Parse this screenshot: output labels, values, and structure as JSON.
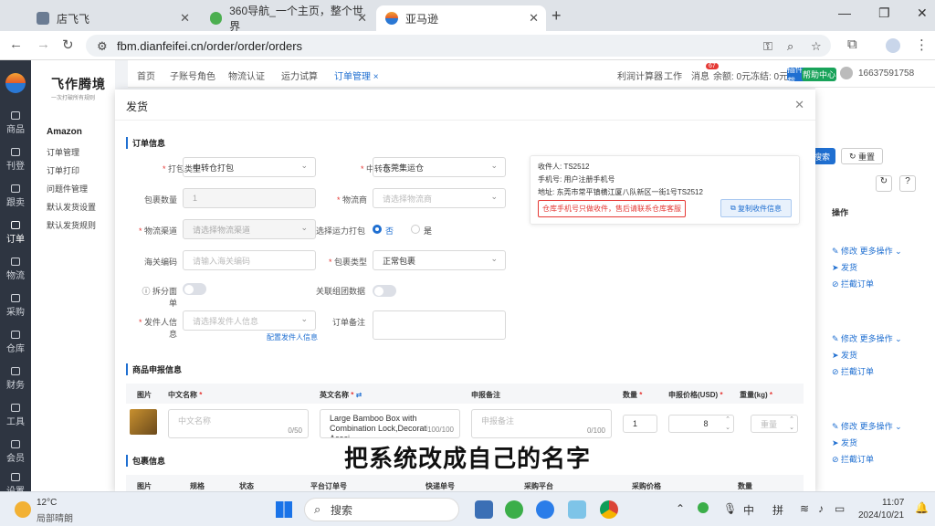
{
  "browser": {
    "tabs": [
      {
        "label": "店飞飞",
        "active": false
      },
      {
        "label": "360导航_一个主页，整个世界",
        "active": false
      },
      {
        "label": "亚马逊",
        "active": true
      }
    ],
    "url": "fbm.dianfeifei.cn/order/order/orders"
  },
  "sidebar": {
    "items": [
      "商品",
      "刊登",
      "跟卖",
      "订单",
      "物流",
      "采购",
      "仓库",
      "财务",
      "工具",
      "会员",
      "设置"
    ]
  },
  "subnav": {
    "logo": "飞作腾境",
    "logo_sub": "一次打破所有规则",
    "section": "Amazon",
    "items": [
      "订单管理",
      "订单打印",
      "问题件管理",
      "默认发货设置",
      "默认发货规则"
    ]
  },
  "topnav": {
    "tabs": [
      "首页",
      "子账号角色",
      "物流认证",
      "运力试算",
      "订单管理 ×"
    ],
    "right": {
      "calc": "利润计算器",
      "tools": "工作",
      "messages": "消息",
      "msg_badge": "67",
      "balance": "余额: 0元",
      "frozen": "冻结: 0元",
      "plugin_btn": "插件下载",
      "help_btn": "帮助中心",
      "phone": "16637591758"
    }
  },
  "background": {
    "search_btn": "搜索",
    "reset_btn": "重置",
    "ops_header": "操作",
    "rows": [
      {
        "edit": "修改",
        "more": "更多操作",
        "ship": "发货",
        "intercept": "拦截订单"
      },
      {
        "edit": "修改",
        "more": "更多操作",
        "ship": "发货",
        "intercept": "拦截订单"
      },
      {
        "edit": "修改",
        "more": "更多操作",
        "ship": "发货",
        "intercept": "拦截订单"
      }
    ]
  },
  "modal": {
    "title": "发货",
    "order_section": "订单信息",
    "fields": {
      "pack_type": {
        "label": "打包类型",
        "value": "中转仓打包"
      },
      "transit_warehouse": {
        "label": "中转仓",
        "value": "东莞集运仓"
      },
      "pack_qty": {
        "label": "包裹数量",
        "value": "1"
      },
      "carrier": {
        "label": "物流商",
        "placeholder": "请选择物流商"
      },
      "channel": {
        "label": "物流渠道",
        "placeholder": "请选择物流渠道"
      },
      "use_cap": {
        "label": "选择运力打包",
        "opt_no": "否",
        "opt_yes": "是"
      },
      "customs": {
        "label": "海关编码",
        "placeholder": "请输入海关编码"
      },
      "pack_kind": {
        "label": "包裹类型",
        "value": "正常包裹"
      },
      "split": {
        "label": "拆分面单"
      },
      "link_data": {
        "label": "关联组团数据"
      },
      "sender": {
        "label": "发件人信息",
        "placeholder": "请选择发件人信息",
        "link": "配置发件人信息"
      },
      "remark": {
        "label": "订单备注"
      }
    },
    "recipient": {
      "name": "收件人: TS2512",
      "phone": "手机号: 用户注册手机号",
      "address": "地址: 东莞市常平镇横江厦八队新区一街1号TS2512",
      "warning": "仓库手机号只做收件，售后请联系仓库客服",
      "copy_btn": "复制收件信息"
    },
    "declare_section": "商品申报信息",
    "declare_headers": [
      "图片",
      "中文名称",
      "英文名称",
      "申报备注",
      "数量",
      "申报价格(USD)",
      "重量(kg)"
    ],
    "declare_row": {
      "cn_placeholder": "中文名称",
      "cn_count": "0/50",
      "en_name": "Large Bamboo Box with Combination Lock,Decorative Acaci",
      "en_count": "100/100",
      "note_placeholder": "申报备注",
      "note_count": "0/100",
      "qty": "1",
      "price": "8",
      "weight_placeholder": "重量"
    },
    "package_section": "包裹信息",
    "package_headers": [
      "图片",
      "规格",
      "状态",
      "平台订单号",
      "快递单号",
      "采购平台",
      "采购价格",
      "数量"
    ]
  },
  "caption": "把系统改成自己的名字",
  "taskbar": {
    "weather_temp": "12°C",
    "weather_text": "局部晴朗",
    "search": "搜索",
    "ime1": "中",
    "ime2": "拼",
    "time": "11:07",
    "date": "2024/10/21"
  },
  "colors": {
    "accent": "#1f6fd1",
    "danger": "#e53935",
    "sidebar": "#2e3541"
  }
}
